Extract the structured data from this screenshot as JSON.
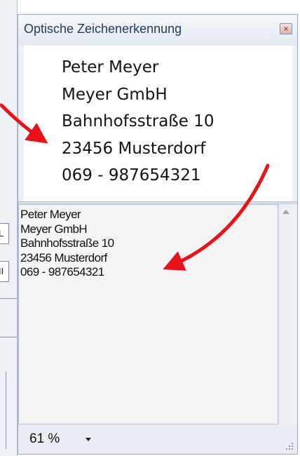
{
  "background_app": {
    "tab_fragments": [
      "L",
      "II"
    ]
  },
  "ocr_panel": {
    "title": "Optische Zeichenerkennung",
    "close_symbol": "×",
    "image_lines": [
      "Peter Meyer",
      "Meyer GmbH",
      "Bahnhofsstraße 10",
      "23456 Musterdorf",
      "069 - 987654321"
    ],
    "text_lines": [
      "Peter Meyer",
      "Meyer GmbH",
      "Bahnhofsstraße 10",
      "23456 Musterdorf",
      "069 - 987654321"
    ],
    "zoom_label": "61 %"
  },
  "colors": {
    "arrow": "#e8121a",
    "title_text": "#1e3a5a",
    "panel_border": "#9aa9bd"
  }
}
